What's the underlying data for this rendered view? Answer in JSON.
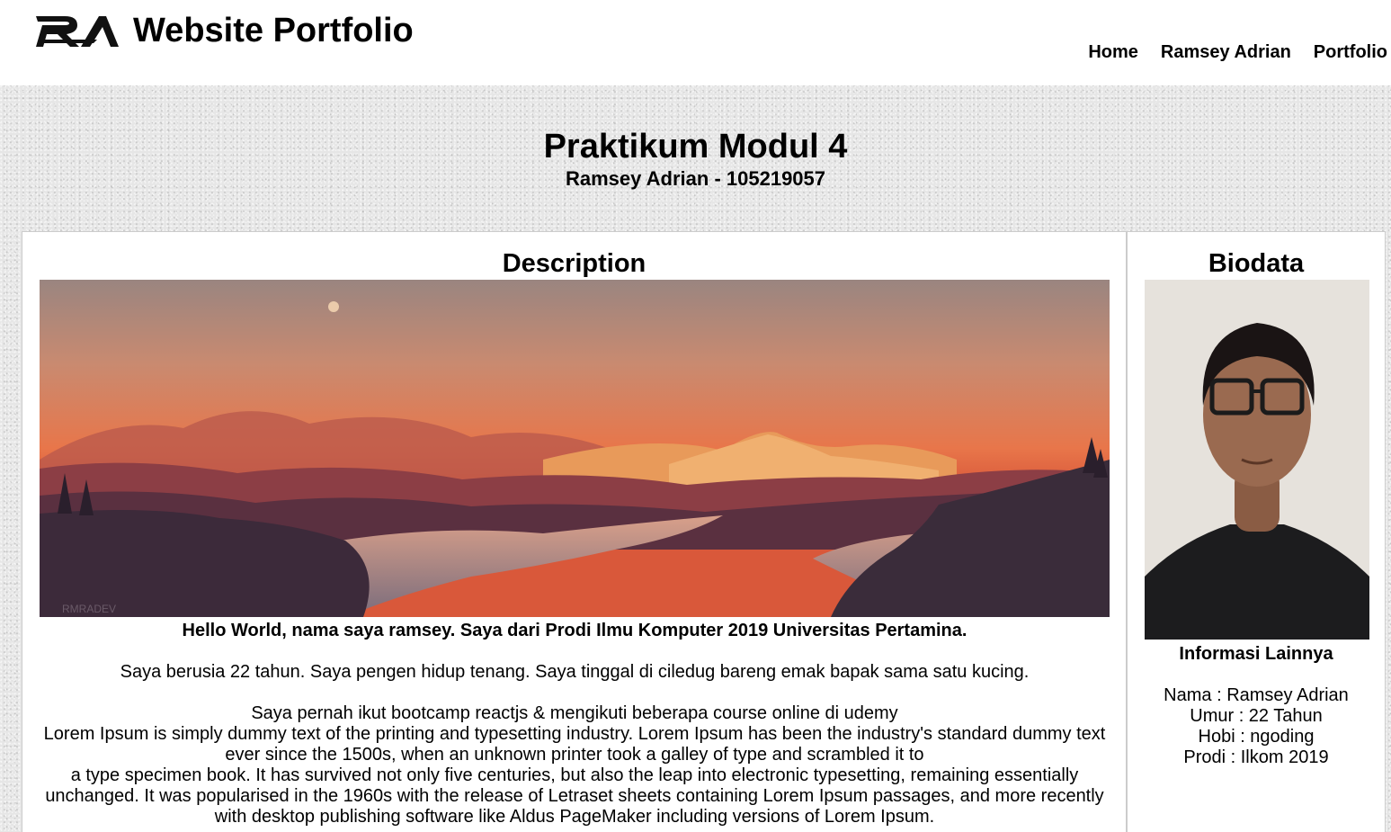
{
  "header": {
    "logo_alt": "RA logo",
    "site_title": "Website Portfolio",
    "nav": [
      "Home",
      "Ramsey Adrian",
      "Portfolio"
    ]
  },
  "hero": {
    "title": "Praktikum Modul 4",
    "subtitle": "Ramsey Adrian - 105219057"
  },
  "description": {
    "heading": "Description",
    "image_signature": "RMRADEV",
    "lead": "Hello World, nama saya ramsey. Saya dari Prodi Ilmu Komputer 2019 Universitas Pertamina.",
    "para1": "Saya berusia 22 tahun. Saya pengen hidup tenang. Saya tinggal di ciledug bareng emak bapak sama satu kucing.",
    "para2_line1": "Saya pernah ikut bootcamp reactjs & mengikuti beberapa course online di udemy",
    "para2_line2": "Lorem Ipsum is simply dummy text of the printing and typesetting industry. Lorem Ipsum has been the industry's standard dummy text ever since the 1500s, when an unknown printer took a galley of type and scrambled it to",
    "para2_line3": "a type specimen book. It has survived not only five centuries, but also the leap into electronic typesetting, remaining essentially unchanged. It was popularised in the 1960s with the release of Letraset sheets containing Lorem Ipsum passages, and more recently with desktop publishing software like Aldus PageMaker including versions of Lorem Ipsum."
  },
  "biodata": {
    "heading": "Biodata",
    "subheading": "Informasi Lainnya",
    "nama": "Nama : Ramsey Adrian",
    "umur": "Umur : 22 Tahun",
    "hobi": "Hobi : ngoding",
    "prodi": "Prodi : Ilkom 2019"
  }
}
